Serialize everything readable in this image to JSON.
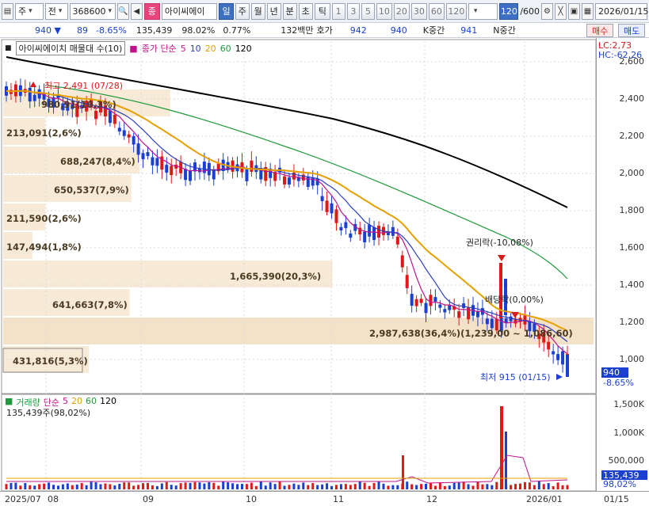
{
  "toolbar": {
    "market": "주",
    "period_type": "전",
    "code": "368600",
    "stock_name": "아이씨에이",
    "tabs": [
      "일",
      "주",
      "월",
      "년",
      "분",
      "초",
      "틱"
    ],
    "active_tab": "일",
    "intervals": [
      "1",
      "3",
      "5",
      "10",
      "20",
      "30",
      "60",
      "120"
    ],
    "count": "120",
    "total": "/600",
    "date": "2026/01/15"
  },
  "quote": {
    "price": "940",
    "change": "89",
    "change_pct": "-8.65%",
    "volume": "135,439",
    "volume_pct": "98.02%",
    "turnover_pct": "0.77%",
    "amount": "132백만",
    "quote_label": "호가",
    "bid": "942",
    "ask": "940",
    "k_label": "K중간",
    "k_value": "941",
    "n_label": "N중간",
    "buy_label": "매수",
    "sell_label": "매도"
  },
  "legend": {
    "name": "아이씨에이치 매물대 수(10)",
    "ma_label": "종가 단순",
    "ma": [
      "5",
      "10",
      "20",
      "60",
      "120"
    ],
    "ma_colors": [
      "#c0148c",
      "#2a3fbf",
      "#e6a000",
      "#1f9a3a",
      "#000000"
    ]
  },
  "price_axis": {
    "lc": "LC:2,73",
    "hc": "HC:-62,26",
    "ticks": [
      "2,600",
      "2,400",
      "2,200",
      "2,000",
      "1,800",
      "1,600",
      "1,400",
      "1,200",
      "1,000"
    ],
    "current": "940",
    "current_pct": "-8.65%"
  },
  "volume_profile": [
    {
      "label": "980,91(10,3%)",
      "value": 980910,
      "pct": 10.3
    },
    {
      "label": "213,091(2,6%)",
      "value": 213091,
      "pct": 2.6
    },
    {
      "label": "688,247(8,4%)",
      "value": 688247,
      "pct": 8.4
    },
    {
      "label": "650,537(7,9%)",
      "value": 650537,
      "pct": 7.9
    },
    {
      "label": "211,590(2,6%)",
      "value": 211590,
      "pct": 2.6
    },
    {
      "label": "147,494(1,8%)",
      "value": 147494,
      "pct": 1.8
    },
    {
      "label": "1,665,390(20,3%)",
      "value": 1665390,
      "pct": 20.3
    },
    {
      "label": "641,663(7,8%)",
      "value": 641663,
      "pct": 7.8
    },
    {
      "label": "2,987,638(36,4%)(1,239,00 ~ 1,086,60)",
      "value": 2987638,
      "pct": 36.4
    },
    {
      "label": "431,816(5,3%)",
      "value": 431816,
      "pct": 5.3
    }
  ],
  "annotations": {
    "high": "최고 2,491 (07/28)",
    "low": "최저 915 (01/15)",
    "rights": "권리락(-10,08%)",
    "dividend": "배당락(0,00%)"
  },
  "volume_panel": {
    "legend_name": "거래량",
    "ma_label": "단순",
    "ma": [
      "5",
      "20",
      "60",
      "120"
    ],
    "info": "135,439주(98,02%)",
    "ticks": [
      "1,500K",
      "1,000K",
      "500,000"
    ],
    "current": "135,439",
    "current_pct": "98,02%"
  },
  "x_axis": [
    "2025/07",
    "08",
    "09",
    "10",
    "11",
    "12",
    "2026/01",
    "01/15"
  ]
}
